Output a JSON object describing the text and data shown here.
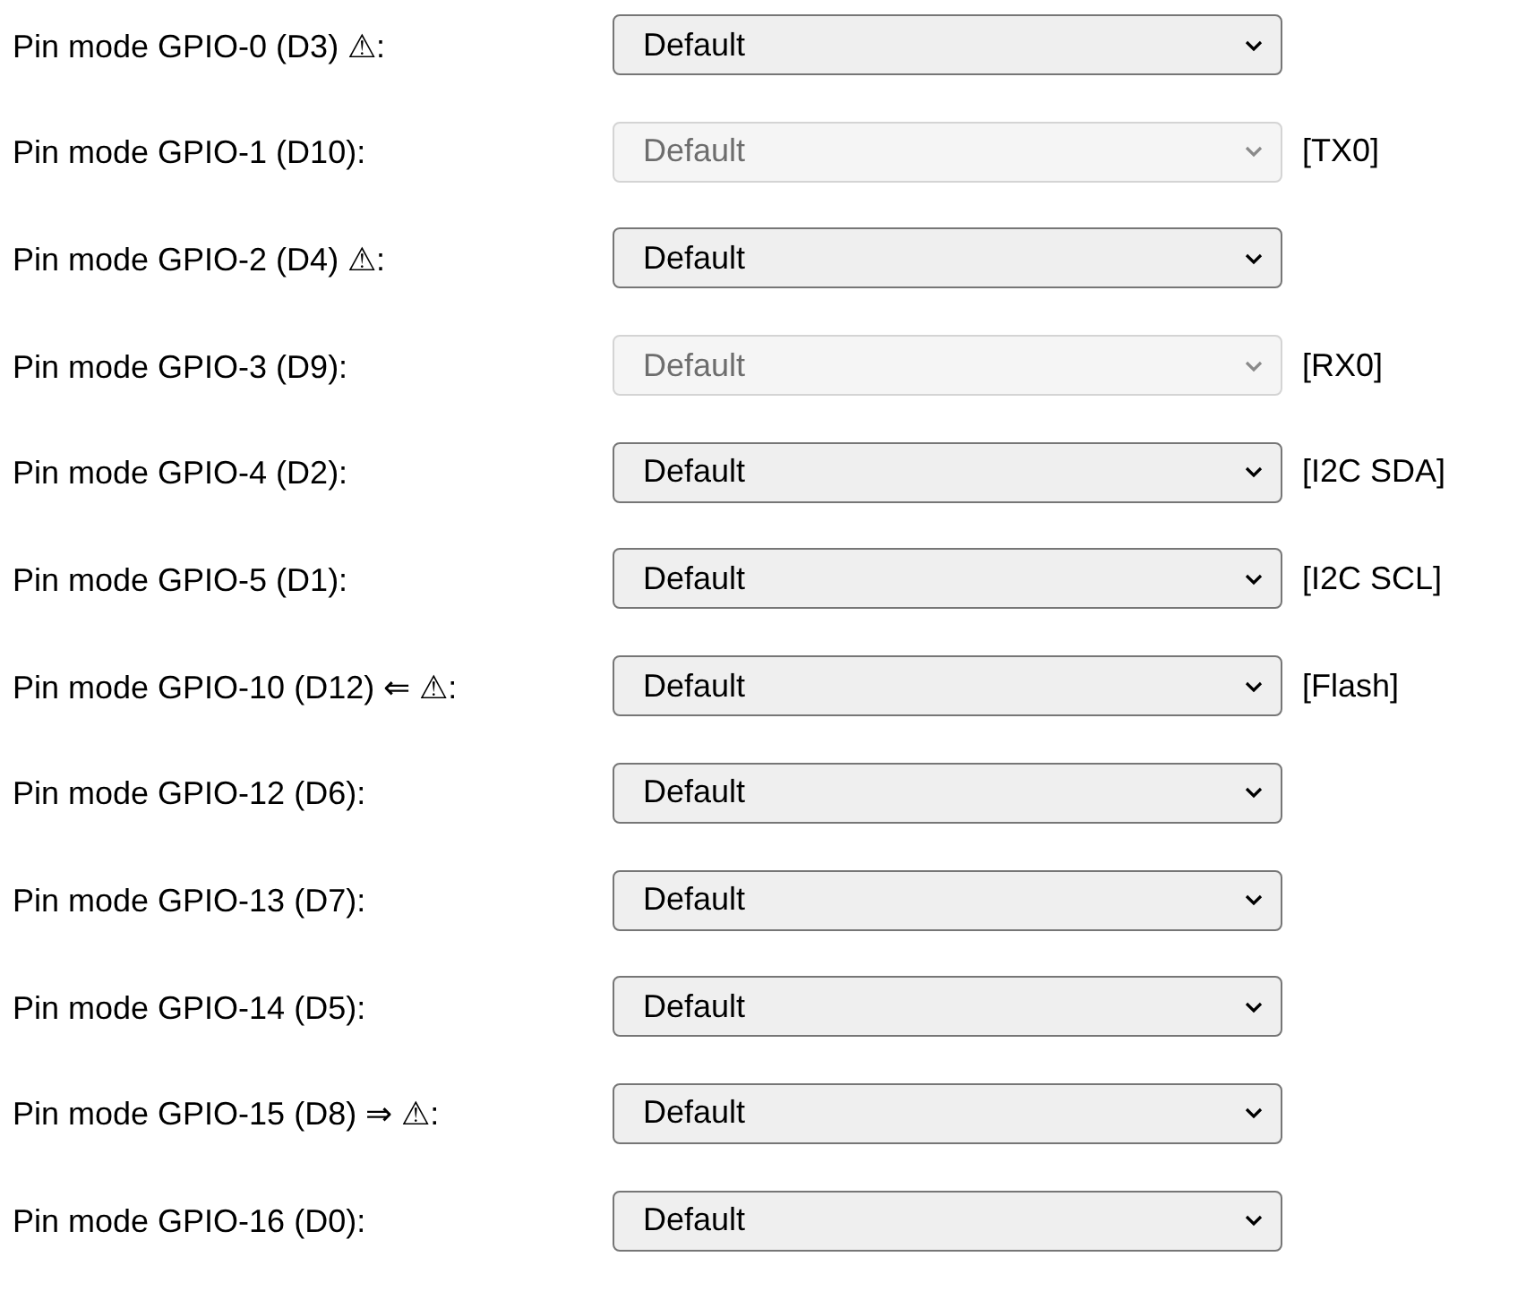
{
  "pins": [
    {
      "label": "Pin mode GPIO-0 (D3) ⚠:",
      "value": "Default",
      "disabled": false
    },
    {
      "label": "Pin mode GPIO-1 (D10):",
      "value": "Default",
      "disabled": true,
      "note": "[TX0]"
    },
    {
      "label": "Pin mode GPIO-2 (D4) ⚠:",
      "value": "Default",
      "disabled": false
    },
    {
      "label": "Pin mode GPIO-3 (D9):",
      "value": "Default",
      "disabled": true,
      "note": "[RX0]"
    },
    {
      "label": "Pin mode GPIO-4 (D2):",
      "value": "Default",
      "disabled": false,
      "note": "[I2C SDA]"
    },
    {
      "label": "Pin mode GPIO-5 (D1):",
      "value": "Default",
      "disabled": false,
      "note": "[I2C SCL]"
    },
    {
      "label": "Pin mode GPIO-10 (D12) ⇐ ⚠:",
      "value": "Default",
      "disabled": false,
      "note": "[Flash]"
    },
    {
      "label": "Pin mode GPIO-12 (D6):",
      "value": "Default",
      "disabled": false
    },
    {
      "label": "Pin mode GPIO-13 (D7):",
      "value": "Default",
      "disabled": false
    },
    {
      "label": "Pin mode GPIO-14 (D5):",
      "value": "Default",
      "disabled": false
    },
    {
      "label": "Pin mode GPIO-15 (D8) ⇒ ⚠:",
      "value": "Default",
      "disabled": false
    },
    {
      "label": "Pin mode GPIO-16 (D0):",
      "value": "Default",
      "disabled": false
    }
  ]
}
